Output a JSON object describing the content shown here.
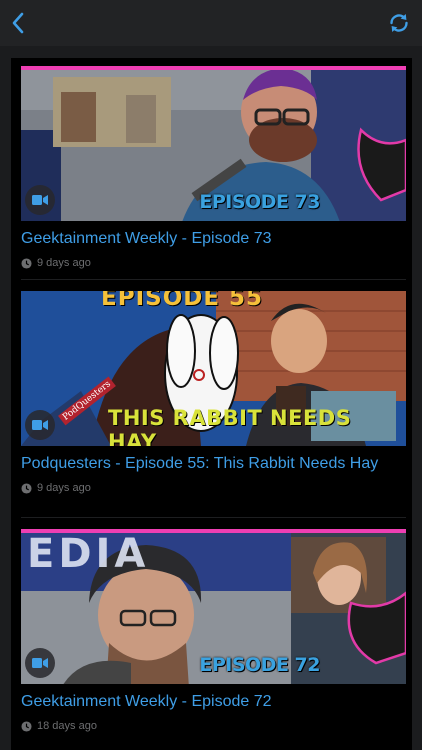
{
  "header": {
    "back_icon": "chevron-left-icon",
    "refresh_icon": "refresh-icon",
    "accent_color": "#3f9ee6"
  },
  "feed": {
    "items": [
      {
        "title": "Geektainment Weekly - Episode 73",
        "posted": "9 days ago",
        "badge": "EPISODE 73",
        "media_icon": "video-camera-icon"
      },
      {
        "title": "Podquesters - Episode 55: This Rabbit Needs Hay",
        "posted": "9 days ago",
        "overlay_top": "EPISODE 55",
        "overlay_bottom": "THIS RABBIT NEEDS HAY",
        "sign_text": "PodQuesters",
        "media_icon": "video-camera-icon"
      },
      {
        "title": "Geektainment Weekly - Episode 72",
        "posted": "18 days ago",
        "badge": "EPISODE 72",
        "backdrop_text": "EDIA",
        "media_icon": "video-camera-icon"
      }
    ]
  },
  "colors": {
    "background": "#1b1c1e",
    "card_background": "#000000",
    "title": "#3f9ee6",
    "meta": "#6d6e70",
    "thumb_border": "#ee3fb3"
  }
}
